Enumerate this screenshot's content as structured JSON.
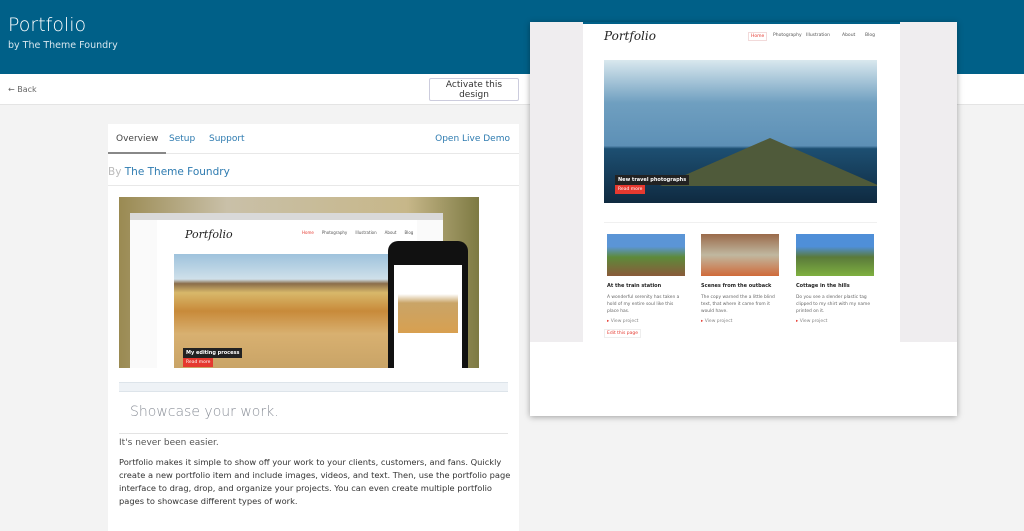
{
  "header": {
    "title": "Portfolio",
    "subtitle": "by The Theme Foundry"
  },
  "toolbar": {
    "back_label": "Back",
    "activate_label": "Activate this design"
  },
  "tabs": [
    {
      "label": "Overview"
    },
    {
      "label": "Setup"
    },
    {
      "label": "Support"
    }
  ],
  "open_demo": "Open Live Demo",
  "byline": {
    "prefix": "By",
    "author": "The Theme Foundry"
  },
  "screenshot": {
    "logo": "Portfolio",
    "nav": [
      "Home",
      "Photography",
      "Illustration",
      "About",
      "Blog"
    ],
    "caption": "My editing process",
    "read_more": "Read more"
  },
  "content": {
    "heading": "Showcase your work.",
    "lead": "It's never been easier.",
    "body": "Portfolio makes it simple to show off your work to your clients, customers, and fans. Quickly create a new portfolio item and include images, videos, and text. Then, use the portfolio page interface to drag, drop, and organize your projects. You can even create multiple portfolio pages to showcase different types of work."
  },
  "preview": {
    "logo": "Portfolio",
    "nav": [
      "Home",
      "Photography",
      "Illustration",
      "About",
      "Blog"
    ],
    "hero_caption": "New travel photographs",
    "read_more": "Read more",
    "posts": [
      {
        "title": "At the train station",
        "desc": "A wonderful serenity has taken a hold of my entire soul like this place has.",
        "link": "View project"
      },
      {
        "title": "Scenes from the outback",
        "desc": "The copy warned the a little blind text, that where it came from it would have.",
        "link": "View project"
      },
      {
        "title": "Cottage in the hills",
        "desc": "Do you see a slender plastic tag clipped to my shirt with my name printed on it.",
        "link": "View project"
      }
    ],
    "edit": "Edit this page"
  },
  "colors": {
    "header": "#006088",
    "link": "#2e7bb0",
    "accent": "#e5392f"
  }
}
